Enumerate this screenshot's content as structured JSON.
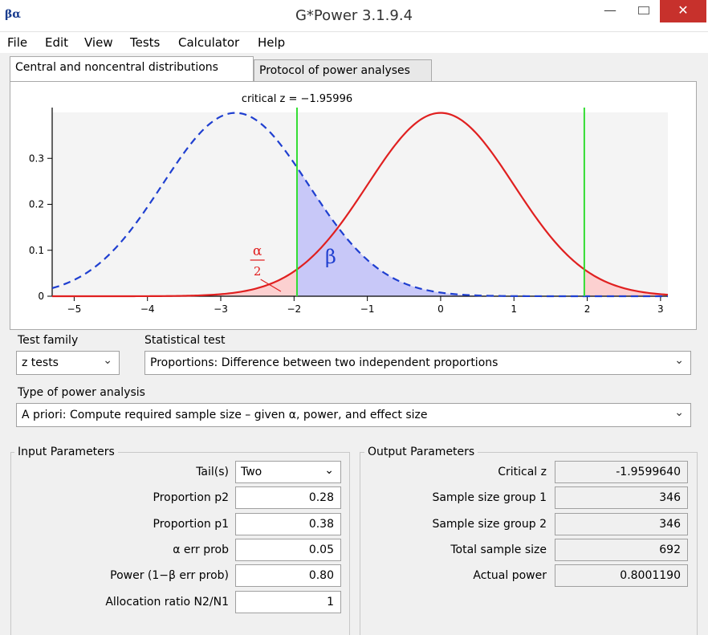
{
  "window": {
    "title": "G*Power 3.1.9.4",
    "app_icon_text": "βα",
    "minimize_glyph": "—",
    "close_glyph": "✕"
  },
  "menu": [
    "File",
    "Edit",
    "View",
    "Tests",
    "Calculator",
    "Help"
  ],
  "tabs": [
    {
      "label": "Central and noncentral distributions",
      "active": true
    },
    {
      "label": "Protocol of power analyses",
      "active": false
    }
  ],
  "chart_data": {
    "type": "line",
    "title": "critical z = −1.95996",
    "x_ticks": [
      "−5",
      "−4",
      "−3",
      "−2",
      "−1",
      "0",
      "1",
      "2",
      "3"
    ],
    "y_ticks": [
      "0",
      "0.1",
      "0.2",
      "0.3"
    ],
    "xlim": [
      -5.3,
      3.1
    ],
    "ylim": [
      0,
      0.4
    ],
    "series": [
      {
        "kind": "central",
        "distribution": "normal",
        "mean": 0,
        "sd": 1,
        "style": "solid",
        "color": "#e02020"
      },
      {
        "kind": "noncentral",
        "distribution": "normal",
        "mean": -2.8,
        "sd": 1,
        "style": "dashed",
        "color": "#1f3fd0"
      }
    ],
    "critical_values": [
      -1.95996,
      1.95996
    ],
    "critical_line_color": "#33dd33",
    "beta_fill_color": "#c8c8f8",
    "alpha_fill_color": "#fcd0d0",
    "annotations": {
      "alpha_numerator": "α",
      "alpha_denominator": "2",
      "beta": "β"
    }
  },
  "test_family": {
    "label": "Test family",
    "value": "z tests"
  },
  "statistical_test": {
    "label": "Statistical test",
    "value": "Proportions: Difference between two independent proportions"
  },
  "power_analysis": {
    "label": "Type of power analysis",
    "value": "A priori: Compute required sample size – given α, power, and effect size"
  },
  "input": {
    "legend": "Input Parameters",
    "tails_label": "Tail(s)",
    "tails_value": "Two",
    "params": [
      {
        "label": "Proportion p2",
        "value": "0.28"
      },
      {
        "label": "Proportion p1",
        "value": "0.38"
      },
      {
        "label": "α err prob",
        "value": "0.05"
      },
      {
        "label": "Power (1−β err prob)",
        "value": "0.80"
      },
      {
        "label": "Allocation ratio N2/N1",
        "value": "1"
      }
    ]
  },
  "output": {
    "legend": "Output Parameters",
    "params": [
      {
        "label": "Critical z",
        "value": "-1.9599640"
      },
      {
        "label": "Sample size group 1",
        "value": "346"
      },
      {
        "label": "Sample size group 2",
        "value": "346"
      },
      {
        "label": "Total sample size",
        "value": "692"
      },
      {
        "label": "Actual power",
        "value": "0.8001190"
      }
    ]
  }
}
